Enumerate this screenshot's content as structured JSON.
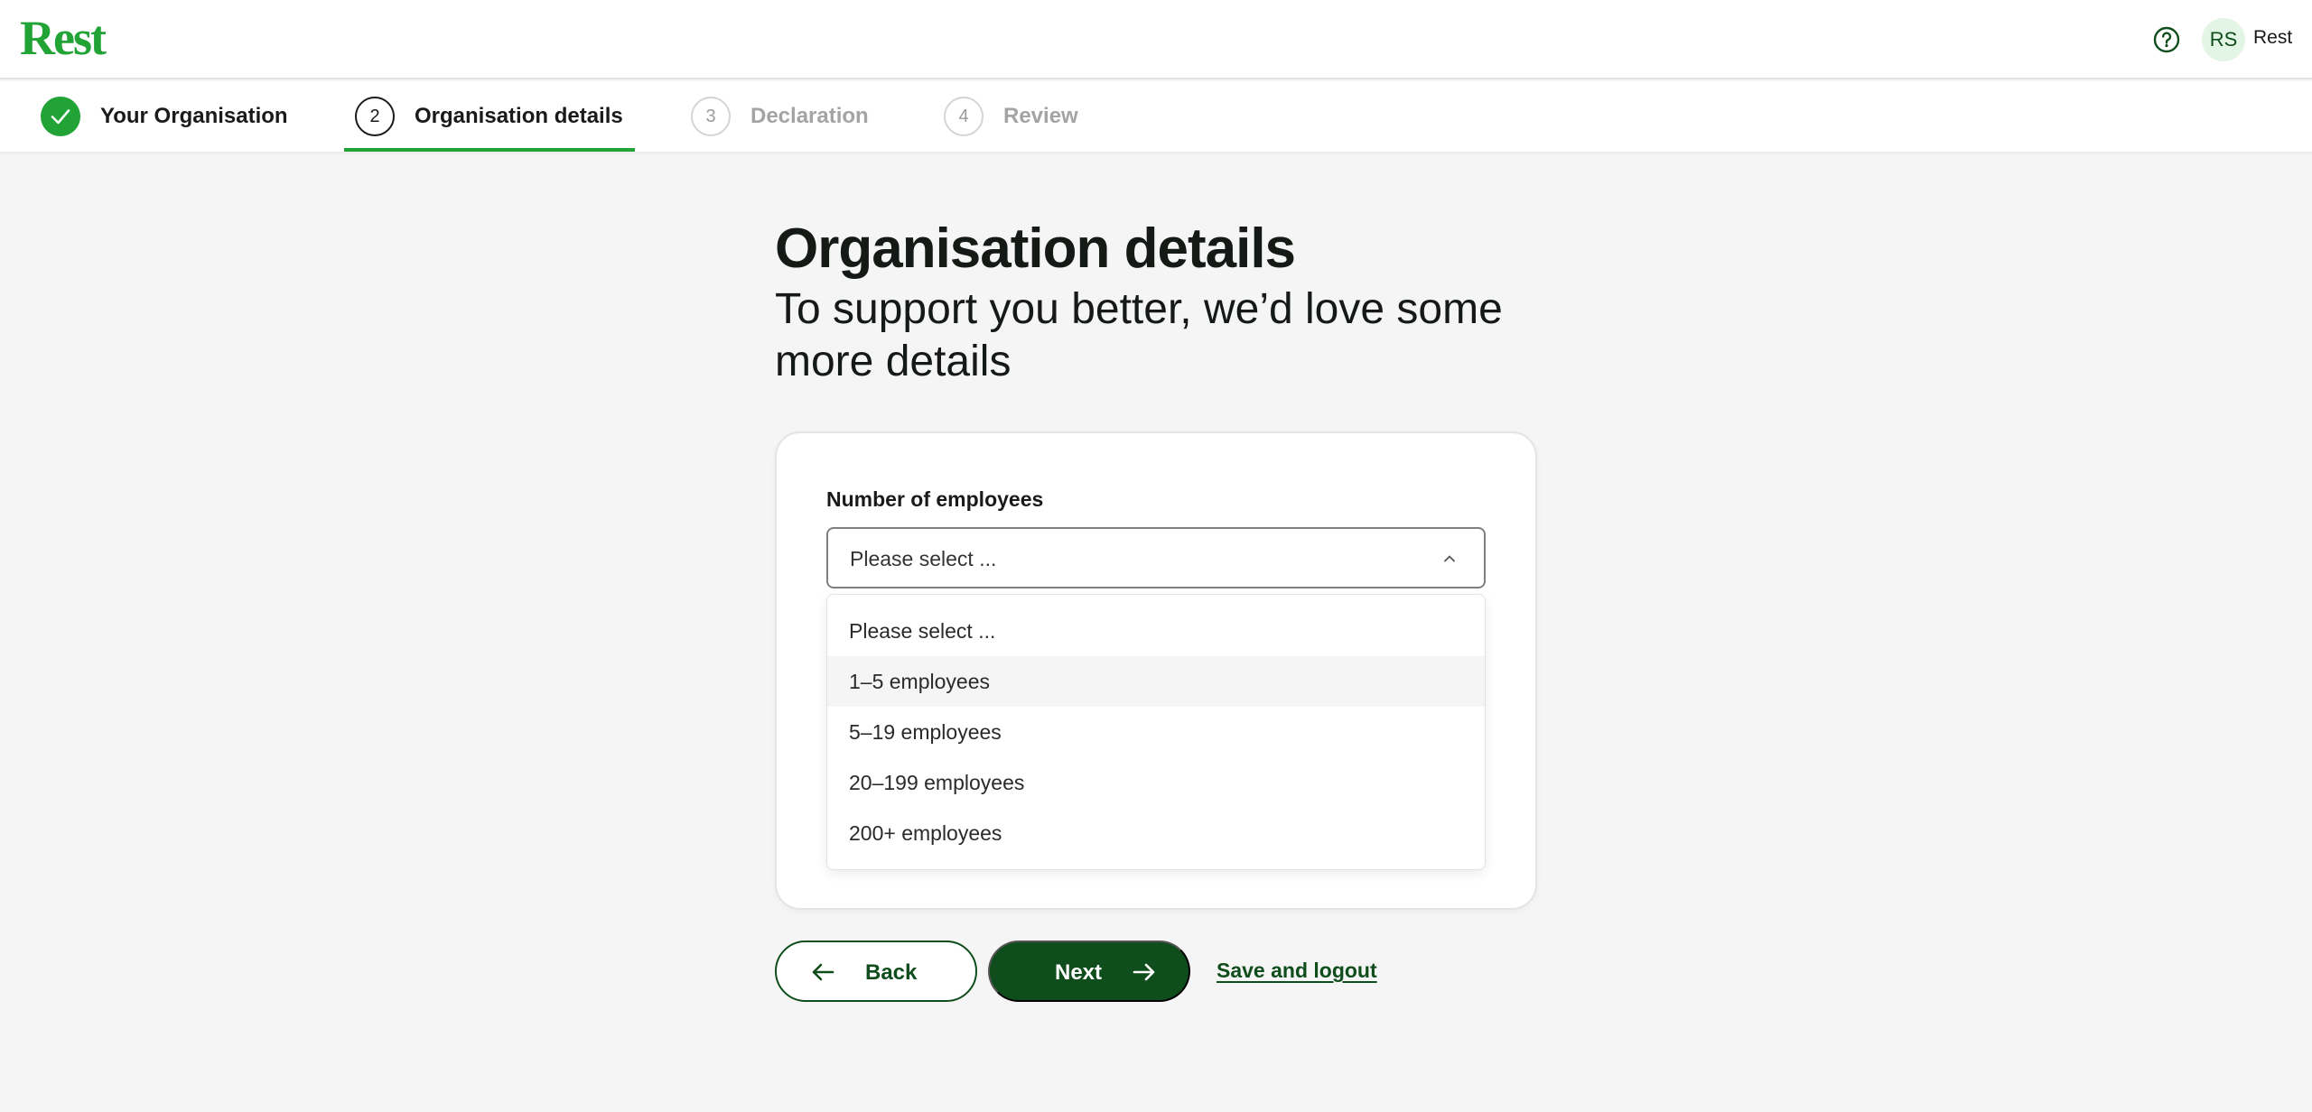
{
  "header": {
    "logo_text": "Rest",
    "help_icon": "question-circle-icon",
    "avatar_initials": "RS",
    "user_name": "Rest"
  },
  "stepper": {
    "steps": [
      {
        "number": "",
        "label": "Your Organisation",
        "state": "done",
        "icon": "check-icon"
      },
      {
        "number": "2",
        "label": "Organisation details",
        "state": "active"
      },
      {
        "number": "3",
        "label": "Declaration",
        "state": "upcoming"
      },
      {
        "number": "4",
        "label": "Review",
        "state": "upcoming"
      }
    ]
  },
  "main": {
    "title": "Organisation details",
    "subtitle": "To support you better, we’d love some more details"
  },
  "form": {
    "employees_label": "Number of employees",
    "employees_value": "Please select ...",
    "options": [
      {
        "label": "Please select ..."
      },
      {
        "label": "1–5 employees",
        "highlighted": true
      },
      {
        "label": "5–19 employees"
      },
      {
        "label": "20–199 employees"
      },
      {
        "label": "200+ employees"
      }
    ]
  },
  "actions": {
    "back_label": "Back",
    "next_label": "Next",
    "save_logout_label": "Save and logout"
  },
  "colors": {
    "brand_green": "#21a336",
    "dark_green": "#0f4d1c",
    "background": "#f4f5f4"
  }
}
